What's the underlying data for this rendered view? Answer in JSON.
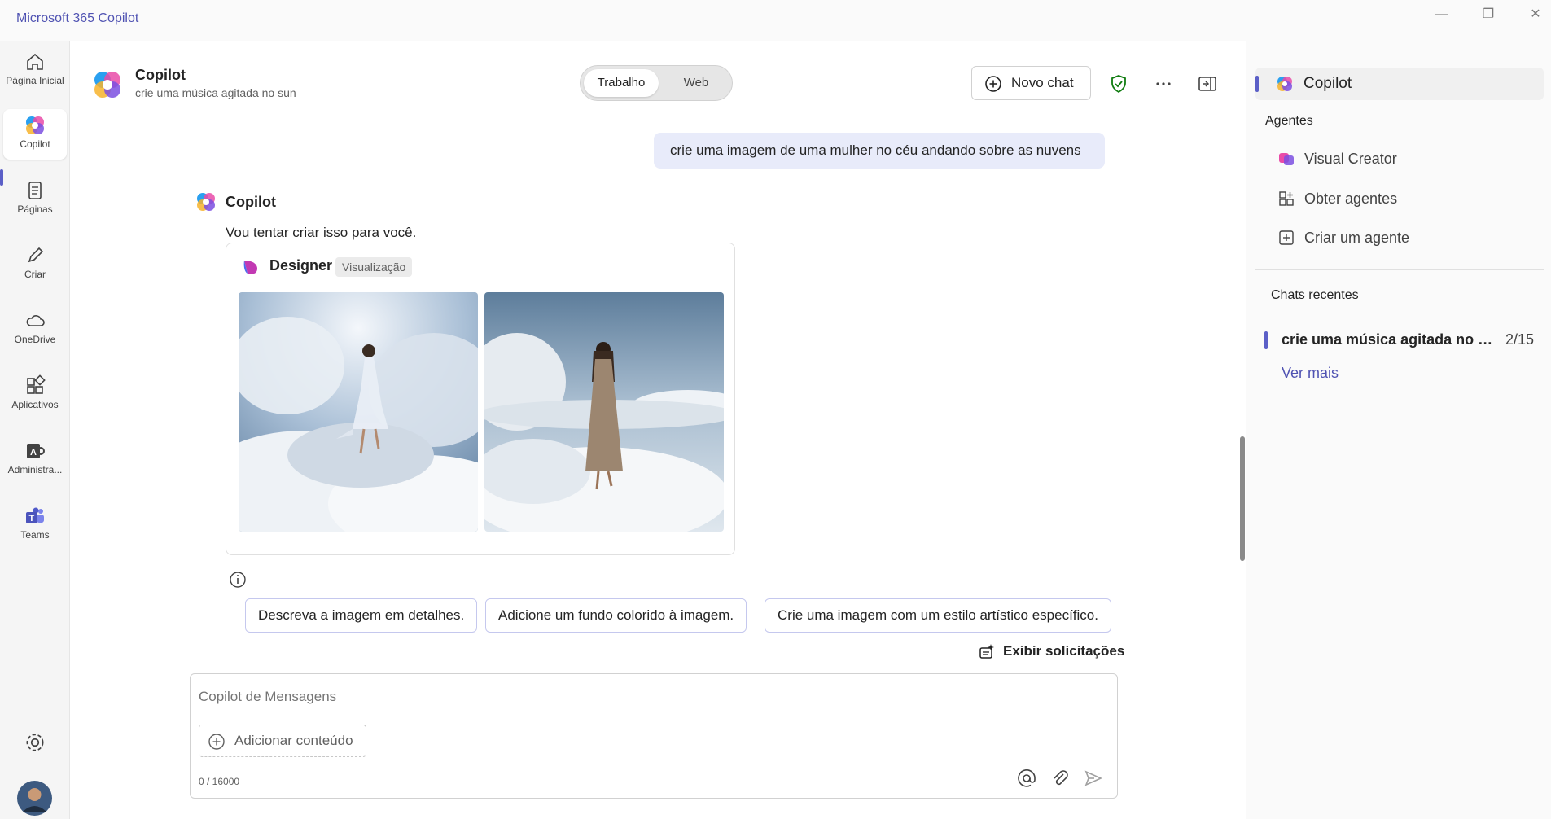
{
  "app": {
    "title": "Microsoft 365 Copilot"
  },
  "window": {
    "minimize": "—",
    "restore": "❐",
    "close": "✕"
  },
  "rail": {
    "items": [
      {
        "label": "Página Inicial",
        "icon": "home-icon"
      },
      {
        "label": "Copilot",
        "icon": "copilot-icon"
      },
      {
        "label": "Páginas",
        "icon": "pages-icon"
      },
      {
        "label": "Criar",
        "icon": "pen-icon"
      },
      {
        "label": "OneDrive",
        "icon": "cloud-icon"
      },
      {
        "label": "Aplicativos",
        "icon": "apps-icon"
      },
      {
        "label": "Administra...",
        "icon": "admin-icon"
      },
      {
        "label": "Teams",
        "icon": "teams-icon"
      }
    ],
    "settings_icon": "gear-icon",
    "avatar_icon": "avatar-icon"
  },
  "header": {
    "title": "Copilot",
    "subtitle": "crie uma música agitada no sun",
    "toggle": {
      "on": "Trabalho",
      "off": "Web"
    },
    "new_chat": "Novo chat"
  },
  "conversation": {
    "user_message": "crie uma imagem de uma mulher no céu andando sobre as nuvens",
    "assistant_name": "Copilot",
    "assistant_text": "Vou tentar criar isso para você.",
    "designer": {
      "name": "Designer",
      "badge": "Visualização"
    }
  },
  "suggestions": [
    "Descreva a imagem em detalhes.",
    "Adicione um fundo colorido à imagem.",
    "Crie uma imagem com um estilo artístico específico."
  ],
  "show_prompts": "Exibir solicitações",
  "composer": {
    "placeholder": "Copilot de Mensagens",
    "add_content": "Adicionar conteúdo",
    "counter": "0 / 16000"
  },
  "right_panel": {
    "copilot": "Copilot",
    "agents_title": "Agentes",
    "agents": [
      "Visual Creator",
      "Obter agentes",
      "Criar um agente"
    ],
    "recent_title": "Chats recentes",
    "recent_chat": "crie uma música agitada no sun",
    "recent_count": "2/15",
    "see_more": "Ver mais"
  },
  "colors": {
    "accent": "#5b5fc7",
    "user_bubble": "#e8ebfa",
    "shield": "#107c10"
  }
}
